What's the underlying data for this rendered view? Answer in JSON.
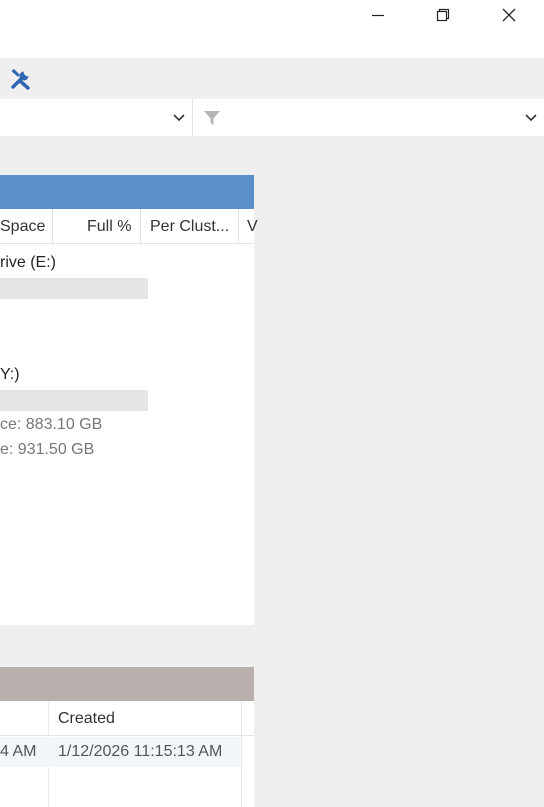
{
  "window": {
    "controls": [
      "minimize",
      "restore",
      "close"
    ]
  },
  "toolbar": {
    "icons": [
      "tools-icon"
    ]
  },
  "filter": {
    "icon": "funnel-icon"
  },
  "drives": {
    "columns": [
      "Space",
      "Full %",
      "Per Clust...",
      "V"
    ],
    "items": [
      {
        "name": "rive (E:)",
        "free": "",
        "size": ""
      },
      {
        "name": "Y:)",
        "free": "ce: 883.10 GB",
        "size": "e: 931.50 GB"
      }
    ],
    "header_color": "#5b8fc9"
  },
  "files": {
    "columns": [
      "",
      "Created"
    ],
    "rows": [
      {
        "modified": "4 AM",
        "created": "1/12/2026 11:15:13 AM"
      }
    ],
    "header_color": "#b9afac"
  }
}
